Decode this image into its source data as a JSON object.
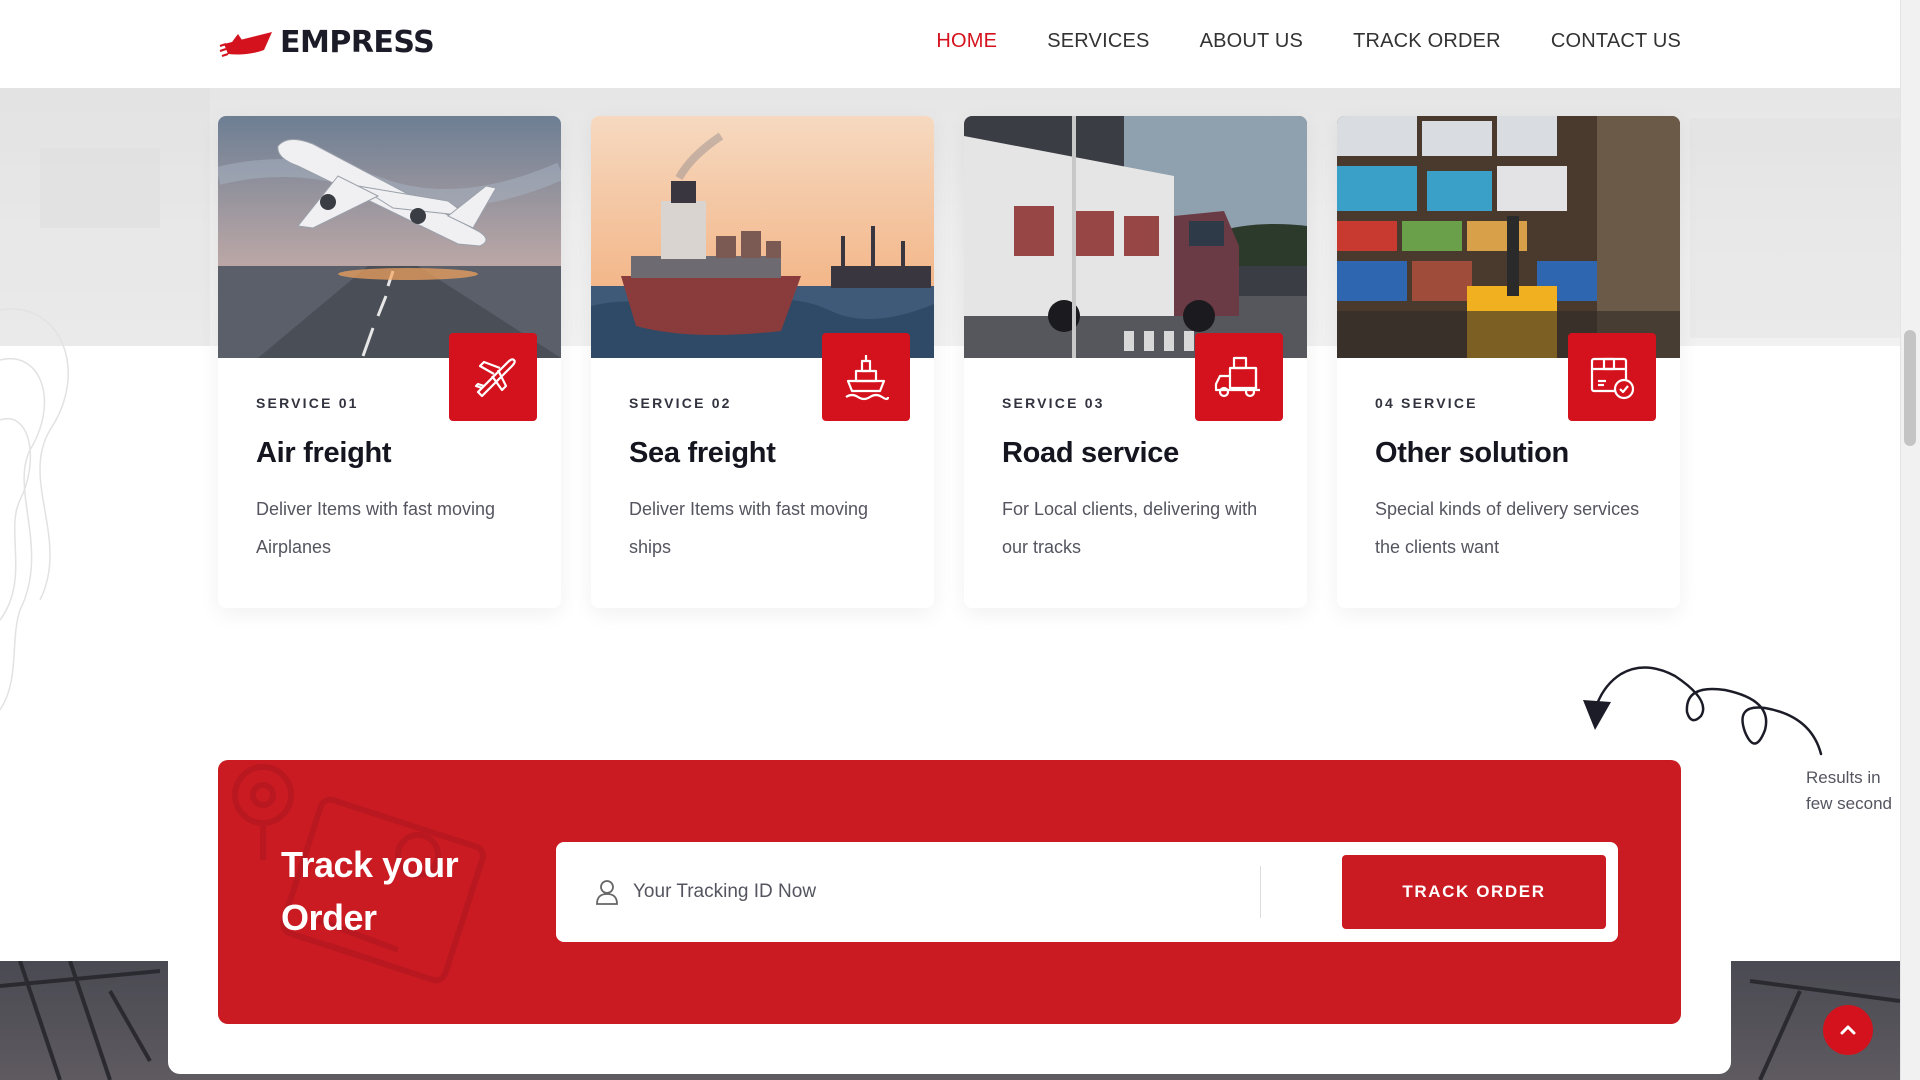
{
  "header": {
    "logo_text": "EMPRESS",
    "nav": [
      {
        "label": "HOME",
        "active": true
      },
      {
        "label": "SERVICES",
        "active": false
      },
      {
        "label": "ABOUT US",
        "active": false
      },
      {
        "label": "TRACK ORDER",
        "active": false
      },
      {
        "label": "CONTACT US",
        "active": false
      }
    ]
  },
  "services": [
    {
      "tag": "SERVICE 01",
      "title": "Air freight",
      "desc": "Deliver Items with fast moving Airplanes",
      "icon": "airplane-icon"
    },
    {
      "tag": "SERVICE 02",
      "title": "Sea freight",
      "desc": "Deliver Items with fast moving ships",
      "icon": "ship-icon"
    },
    {
      "tag": "SERVICE 03",
      "title": "Road service",
      "desc": "For Local clients, delivering with our tracks",
      "icon": "truck-icon"
    },
    {
      "tag": "04 SERVICE",
      "title": "Other solution",
      "desc": "Special kinds of delivery services the clients want",
      "icon": "delivery-box-icon"
    }
  ],
  "annotation": {
    "line1": "Results in",
    "line2": "few second"
  },
  "tracking": {
    "title": "Track your Order",
    "placeholder": "Your Tracking ID Now",
    "button_label": "TRACK ORDER"
  },
  "colors": {
    "brand_red": "#d4121d",
    "track_red": "#cb1b22",
    "text_dark": "#1c1c28"
  }
}
